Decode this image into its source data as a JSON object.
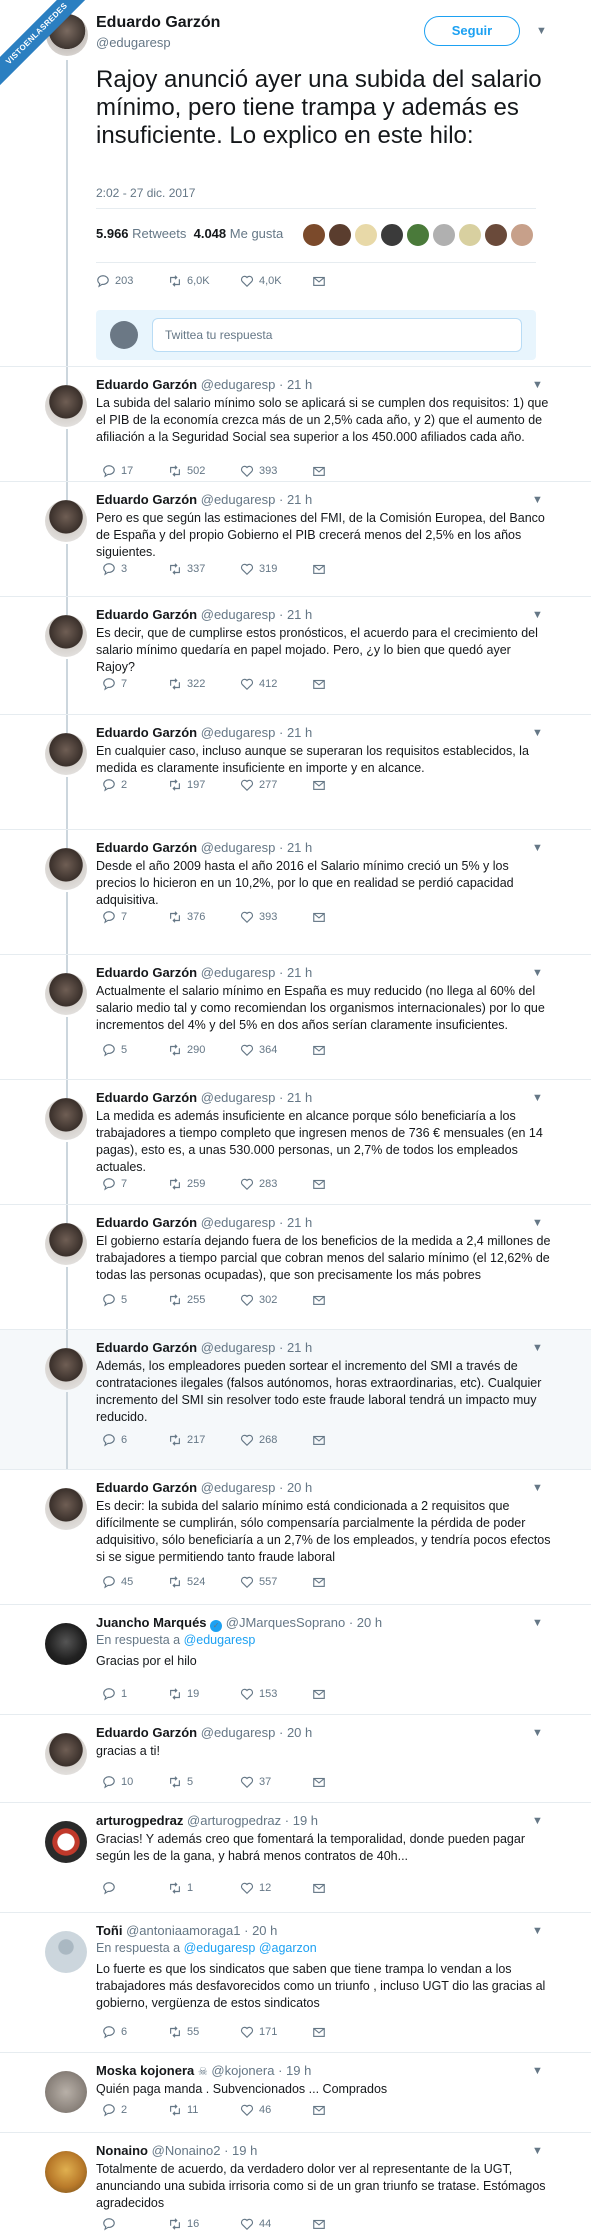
{
  "ribbon": "VISTOENLASREDES",
  "main_tweet": {
    "name": "Eduardo Garzón",
    "handle": "@edugaresp",
    "follow_label": "Seguir",
    "text": "Rajoy anunció ayer una subida del salario mínimo, pero tiene trampa y además es insuficiente. Lo explico en este hilo:",
    "datetime": "2:02 - 27 dic. 2017",
    "retweets_count": "5.966",
    "retweets_label": "Retweets",
    "likes_count": "4.048",
    "likes_label": "Me gusta",
    "replies": "203",
    "rts": "6,0K",
    "likes": "4,0K",
    "reply_placeholder": "Twittea tu respuesta"
  },
  "colors": {
    "accent": "#1da1f2",
    "muted": "#657786",
    "highlight_bg": "#f5f8fa",
    "ribbon": "#2b7fc1"
  },
  "tweets": [
    {
      "name": "Eduardo Garzón",
      "handle": "@edugaresp",
      "time": "21 h",
      "text": "La subida del salario mínimo solo se aplicará si se cumplen dos requisitos: 1) que el PIB de la economía crezca más de un 2,5% cada año, y 2) que el aumento de afiliación a la Seguridad Social sea superior a los 450.000 afiliados cada año.",
      "replies": "17",
      "rts": "502",
      "likes": "393"
    },
    {
      "name": "Eduardo Garzón",
      "handle": "@edugaresp",
      "time": "21 h",
      "text": "Pero es que según las estimaciones del FMI, de la Comisión Europea, del Banco de España y del propio Gobierno el PIB crecerá menos del 2,5% en los años siguientes.",
      "replies": "3",
      "rts": "337",
      "likes": "319"
    },
    {
      "name": "Eduardo Garzón",
      "handle": "@edugaresp",
      "time": "21 h",
      "text": "Es decir, que de cumplirse estos pronósticos, el acuerdo para el crecimiento del salario mínimo quedaría en papel mojado. Pero, ¿y lo bien que quedó ayer Rajoy?",
      "replies": "7",
      "rts": "322",
      "likes": "412"
    },
    {
      "name": "Eduardo Garzón",
      "handle": "@edugaresp",
      "time": "21 h",
      "text": "En cualquier caso, incluso aunque se superaran los requisitos establecidos, la medida es claramente insuficiente en importe y en alcance.",
      "replies": "2",
      "rts": "197",
      "likes": "277"
    },
    {
      "name": "Eduardo Garzón",
      "handle": "@edugaresp",
      "time": "21 h",
      "text": "Desde el año 2009 hasta el año 2016 el Salario mínimo creció un 5% y los precios lo hicieron en un 10,2%, por lo que en realidad se perdió capacidad adquisitiva.",
      "replies": "7",
      "rts": "376",
      "likes": "393"
    },
    {
      "name": "Eduardo Garzón",
      "handle": "@edugaresp",
      "time": "21 h",
      "text": "Actualmente el salario mínimo en España es muy reducido (no llega al 60% del salario medio tal y como recomiendan los organismos internacionales) por lo que incrementos del 4% y del 5% en dos años serían claramente insuficientes.",
      "replies": "5",
      "rts": "290",
      "likes": "364"
    },
    {
      "name": "Eduardo Garzón",
      "handle": "@edugaresp",
      "time": "21 h",
      "text": "La medida es además insuficiente en alcance porque sólo beneficiaría a los trabajadores a tiempo completo que ingresen menos de 736 € mensuales (en 14 pagas), esto es, a unas 530.000 personas, un 2,7% de todos los empleados actuales.",
      "replies": "7",
      "rts": "259",
      "likes": "283"
    },
    {
      "name": "Eduardo Garzón",
      "handle": "@edugaresp",
      "time": "21 h",
      "text": "El gobierno estaría dejando fuera de los beneficios de la medida a 2,4 millones de trabajadores a tiempo parcial que cobran menos del salario mínimo (el 12,62% de todas las personas ocupadas), que son precisamente los más pobres",
      "replies": "5",
      "rts": "255",
      "likes": "302"
    },
    {
      "name": "Eduardo Garzón",
      "handle": "@edugaresp",
      "time": "21 h",
      "text": "Además, los empleadores pueden sortear el incremento del SMI a través de contrataciones ilegales (falsos autónomos, horas extraordinarias, etc). Cualquier incremento del SMI sin resolver todo este fraude laboral tendrá un impacto muy reducido.",
      "replies": "6",
      "rts": "217",
      "likes": "268"
    },
    {
      "name": "Eduardo Garzón",
      "handle": "@edugaresp",
      "time": "20 h",
      "text": "Es decir: la subida del salario mínimo está condicionada a 2 requisitos que difícilmente se cumplirán, sólo compensaría parcialmente la pérdida de poder adquisitivo, sólo beneficiaría a un 2,7% de los empleados, y tendría pocos efectos si se sigue permitiendo tanto fraude laboral",
      "replies": "45",
      "rts": "524",
      "likes": "557"
    },
    {
      "name": "Juancho Marqués",
      "handle": "@JMarquesSoprano",
      "time": "20 h",
      "in_reply_label": "En respuesta a",
      "in_reply_to": "@edugaresp",
      "text": "Gracias por el hilo",
      "replies": "1",
      "rts": "19",
      "likes": "153"
    },
    {
      "name": "Eduardo Garzón",
      "handle": "@edugaresp",
      "time": "20 h",
      "text": "gracias a ti!",
      "replies": "10",
      "rts": "5",
      "likes": "37"
    },
    {
      "name": "arturogpedraz",
      "handle": "@arturogpedraz",
      "time": "19 h",
      "text": "Gracias! Y además creo que fomentará la temporalidad, donde pueden pagar según les de la gana, y habrá menos contratos de 40h...",
      "replies": "",
      "rts": "1",
      "likes": "12"
    },
    {
      "name": "Toñi",
      "handle": "@antoniaamoraga1",
      "time": "20 h",
      "in_reply_label": "En respuesta a",
      "in_reply_to": "@edugaresp @agarzon",
      "text": "Lo fuerte es que los sindicatos que saben que tiene trampa lo vendan a los trabajadores más desfavorecidos como un triunfo , incluso UGT dio las gracias al gobierno, vergüenza de estos sindicatos",
      "replies": "6",
      "rts": "55",
      "likes": "171"
    },
    {
      "name": "Moska kojonera",
      "handle": "@kojonera",
      "time": "19 h",
      "text": "Quién paga manda . Subvencionados ...  Comprados",
      "replies": "2",
      "rts": "11",
      "likes": "46"
    },
    {
      "name": "Nonaino",
      "handle": "@Nonaino2",
      "time": "19 h",
      "text": "Totalmente de acuerdo, da verdadero dolor ver al representante de la UGT, anunciando una subida irrisoria como si de un gran triunfo se tratase. Estómagos agradecidos",
      "replies": "",
      "rts": "16",
      "likes": "44"
    }
  ]
}
